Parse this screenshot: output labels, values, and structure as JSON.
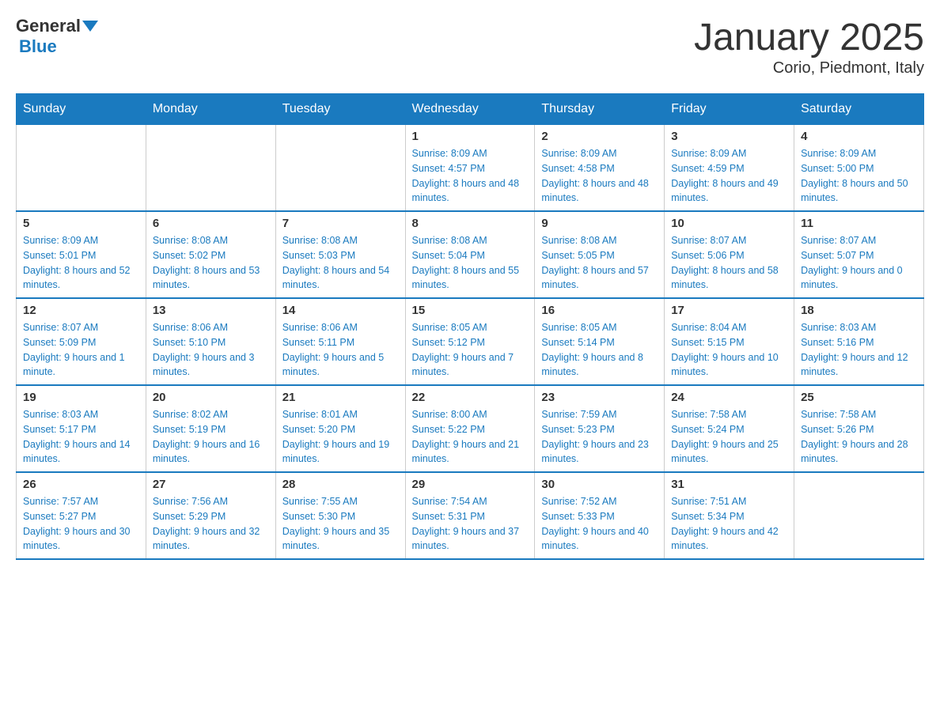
{
  "header": {
    "logo_general": "General",
    "logo_blue": "Blue",
    "title": "January 2025",
    "subtitle": "Corio, Piedmont, Italy"
  },
  "days_of_week": [
    "Sunday",
    "Monday",
    "Tuesday",
    "Wednesday",
    "Thursday",
    "Friday",
    "Saturday"
  ],
  "weeks": [
    [
      {
        "day": "",
        "info": ""
      },
      {
        "day": "",
        "info": ""
      },
      {
        "day": "",
        "info": ""
      },
      {
        "day": "1",
        "info": "Sunrise: 8:09 AM\nSunset: 4:57 PM\nDaylight: 8 hours and 48 minutes."
      },
      {
        "day": "2",
        "info": "Sunrise: 8:09 AM\nSunset: 4:58 PM\nDaylight: 8 hours and 48 minutes."
      },
      {
        "day": "3",
        "info": "Sunrise: 8:09 AM\nSunset: 4:59 PM\nDaylight: 8 hours and 49 minutes."
      },
      {
        "day": "4",
        "info": "Sunrise: 8:09 AM\nSunset: 5:00 PM\nDaylight: 8 hours and 50 minutes."
      }
    ],
    [
      {
        "day": "5",
        "info": "Sunrise: 8:09 AM\nSunset: 5:01 PM\nDaylight: 8 hours and 52 minutes."
      },
      {
        "day": "6",
        "info": "Sunrise: 8:08 AM\nSunset: 5:02 PM\nDaylight: 8 hours and 53 minutes."
      },
      {
        "day": "7",
        "info": "Sunrise: 8:08 AM\nSunset: 5:03 PM\nDaylight: 8 hours and 54 minutes."
      },
      {
        "day": "8",
        "info": "Sunrise: 8:08 AM\nSunset: 5:04 PM\nDaylight: 8 hours and 55 minutes."
      },
      {
        "day": "9",
        "info": "Sunrise: 8:08 AM\nSunset: 5:05 PM\nDaylight: 8 hours and 57 minutes."
      },
      {
        "day": "10",
        "info": "Sunrise: 8:07 AM\nSunset: 5:06 PM\nDaylight: 8 hours and 58 minutes."
      },
      {
        "day": "11",
        "info": "Sunrise: 8:07 AM\nSunset: 5:07 PM\nDaylight: 9 hours and 0 minutes."
      }
    ],
    [
      {
        "day": "12",
        "info": "Sunrise: 8:07 AM\nSunset: 5:09 PM\nDaylight: 9 hours and 1 minute."
      },
      {
        "day": "13",
        "info": "Sunrise: 8:06 AM\nSunset: 5:10 PM\nDaylight: 9 hours and 3 minutes."
      },
      {
        "day": "14",
        "info": "Sunrise: 8:06 AM\nSunset: 5:11 PM\nDaylight: 9 hours and 5 minutes."
      },
      {
        "day": "15",
        "info": "Sunrise: 8:05 AM\nSunset: 5:12 PM\nDaylight: 9 hours and 7 minutes."
      },
      {
        "day": "16",
        "info": "Sunrise: 8:05 AM\nSunset: 5:14 PM\nDaylight: 9 hours and 8 minutes."
      },
      {
        "day": "17",
        "info": "Sunrise: 8:04 AM\nSunset: 5:15 PM\nDaylight: 9 hours and 10 minutes."
      },
      {
        "day": "18",
        "info": "Sunrise: 8:03 AM\nSunset: 5:16 PM\nDaylight: 9 hours and 12 minutes."
      }
    ],
    [
      {
        "day": "19",
        "info": "Sunrise: 8:03 AM\nSunset: 5:17 PM\nDaylight: 9 hours and 14 minutes."
      },
      {
        "day": "20",
        "info": "Sunrise: 8:02 AM\nSunset: 5:19 PM\nDaylight: 9 hours and 16 minutes."
      },
      {
        "day": "21",
        "info": "Sunrise: 8:01 AM\nSunset: 5:20 PM\nDaylight: 9 hours and 19 minutes."
      },
      {
        "day": "22",
        "info": "Sunrise: 8:00 AM\nSunset: 5:22 PM\nDaylight: 9 hours and 21 minutes."
      },
      {
        "day": "23",
        "info": "Sunrise: 7:59 AM\nSunset: 5:23 PM\nDaylight: 9 hours and 23 minutes."
      },
      {
        "day": "24",
        "info": "Sunrise: 7:58 AM\nSunset: 5:24 PM\nDaylight: 9 hours and 25 minutes."
      },
      {
        "day": "25",
        "info": "Sunrise: 7:58 AM\nSunset: 5:26 PM\nDaylight: 9 hours and 28 minutes."
      }
    ],
    [
      {
        "day": "26",
        "info": "Sunrise: 7:57 AM\nSunset: 5:27 PM\nDaylight: 9 hours and 30 minutes."
      },
      {
        "day": "27",
        "info": "Sunrise: 7:56 AM\nSunset: 5:29 PM\nDaylight: 9 hours and 32 minutes."
      },
      {
        "day": "28",
        "info": "Sunrise: 7:55 AM\nSunset: 5:30 PM\nDaylight: 9 hours and 35 minutes."
      },
      {
        "day": "29",
        "info": "Sunrise: 7:54 AM\nSunset: 5:31 PM\nDaylight: 9 hours and 37 minutes."
      },
      {
        "day": "30",
        "info": "Sunrise: 7:52 AM\nSunset: 5:33 PM\nDaylight: 9 hours and 40 minutes."
      },
      {
        "day": "31",
        "info": "Sunrise: 7:51 AM\nSunset: 5:34 PM\nDaylight: 9 hours and 42 minutes."
      },
      {
        "day": "",
        "info": ""
      }
    ]
  ]
}
